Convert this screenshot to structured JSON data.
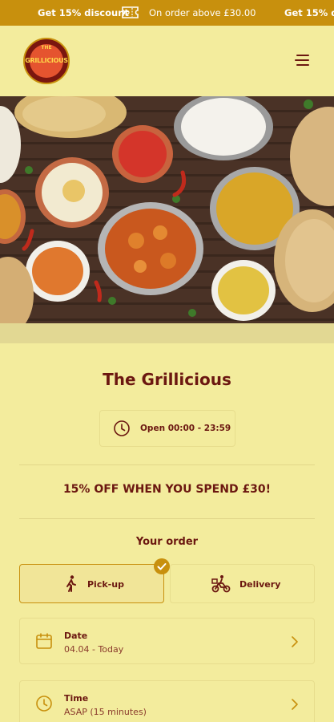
{
  "promo_bar": {
    "discount_label": "Get 15% discount",
    "condition": "On order above £30.00",
    "discount_label_repeat": "Get 15% disc"
  },
  "header": {
    "logo_top": "THE",
    "logo_name": "GRILLICIOUS",
    "menu_icon": "hamburger-menu-icon"
  },
  "restaurant": {
    "name": "The Grillicious",
    "hours": "Open 00:00 - 23:59",
    "promo": "15% OFF WHEN YOU SPEND £30!"
  },
  "order": {
    "heading": "Your order",
    "pickup_label": "Pick-up",
    "delivery_label": "Delivery",
    "selected": "pickup"
  },
  "fields": {
    "date_label": "Date",
    "date_value": "04.04 - Today",
    "time_label": "Time",
    "time_value": "ASAP (15 minutes)"
  },
  "colors": {
    "background": "#f3ec9d",
    "accent": "#c8900d",
    "text": "#6b1710"
  }
}
